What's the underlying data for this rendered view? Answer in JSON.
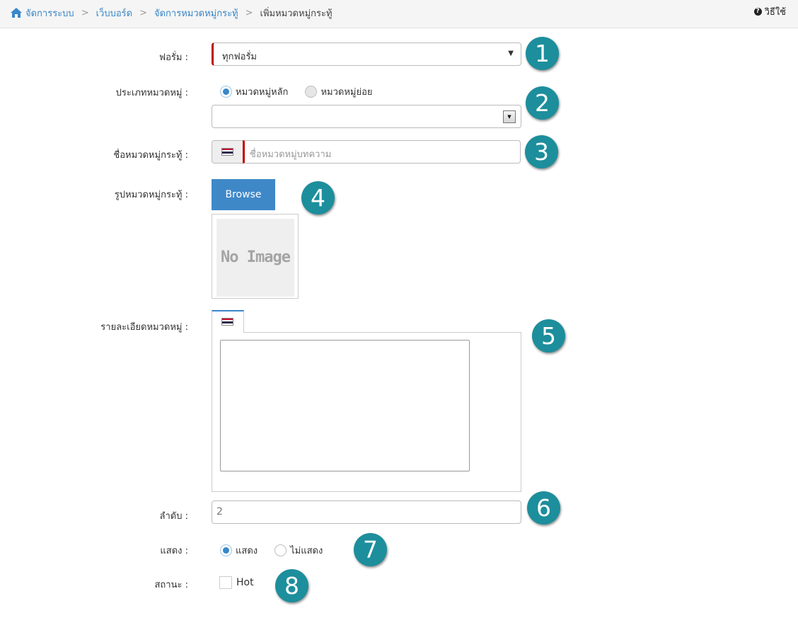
{
  "breadcrumb": {
    "items": [
      "จัดการระบบ",
      "เว็บบอร์ด",
      "จัดการหมวดหมู่กระทู้"
    ],
    "current": "เพิ่มหมวดหมู่กระทู้",
    "separator": ">"
  },
  "help": {
    "label": "วิธีใช้",
    "icon": "question-circle-icon"
  },
  "form": {
    "forum": {
      "label": "ฟอรั่ม :",
      "value": "ทุกฟอรั่ม"
    },
    "category_type": {
      "label": "ประเภทหมวดหมู่ :",
      "options": [
        "หมวดหมู่หลัก",
        "หมวดหมู่ย่อย"
      ],
      "selected": "หมวดหมู่หลัก",
      "sub_value": ""
    },
    "category_name": {
      "label": "ชื่อหมวดหมู่กระทู้ :",
      "placeholder": "ชื่อหมวดหมู่บทความ",
      "value": ""
    },
    "category_image": {
      "label": "รูปหมวดหมู่กระทู้ :",
      "browse_label": "Browse",
      "no_image_text": "No Image"
    },
    "category_detail": {
      "label": "รายละเอียดหมวดหมู่ :",
      "value": ""
    },
    "order": {
      "label": "ลำดับ :",
      "value": "2"
    },
    "display": {
      "label": "แสดง :",
      "options": [
        "แสดง",
        "ไม่แสดง"
      ],
      "selected": "แสดง"
    },
    "status": {
      "label": "สถานะ :",
      "option": "Hot",
      "checked": false
    }
  },
  "badges": [
    "1",
    "2",
    "3",
    "4",
    "5",
    "6",
    "7",
    "8"
  ],
  "colors": {
    "accent": "#3a87c8",
    "required": "#c00000",
    "badge": "#1d8e9c",
    "browse": "#3f88c8"
  }
}
